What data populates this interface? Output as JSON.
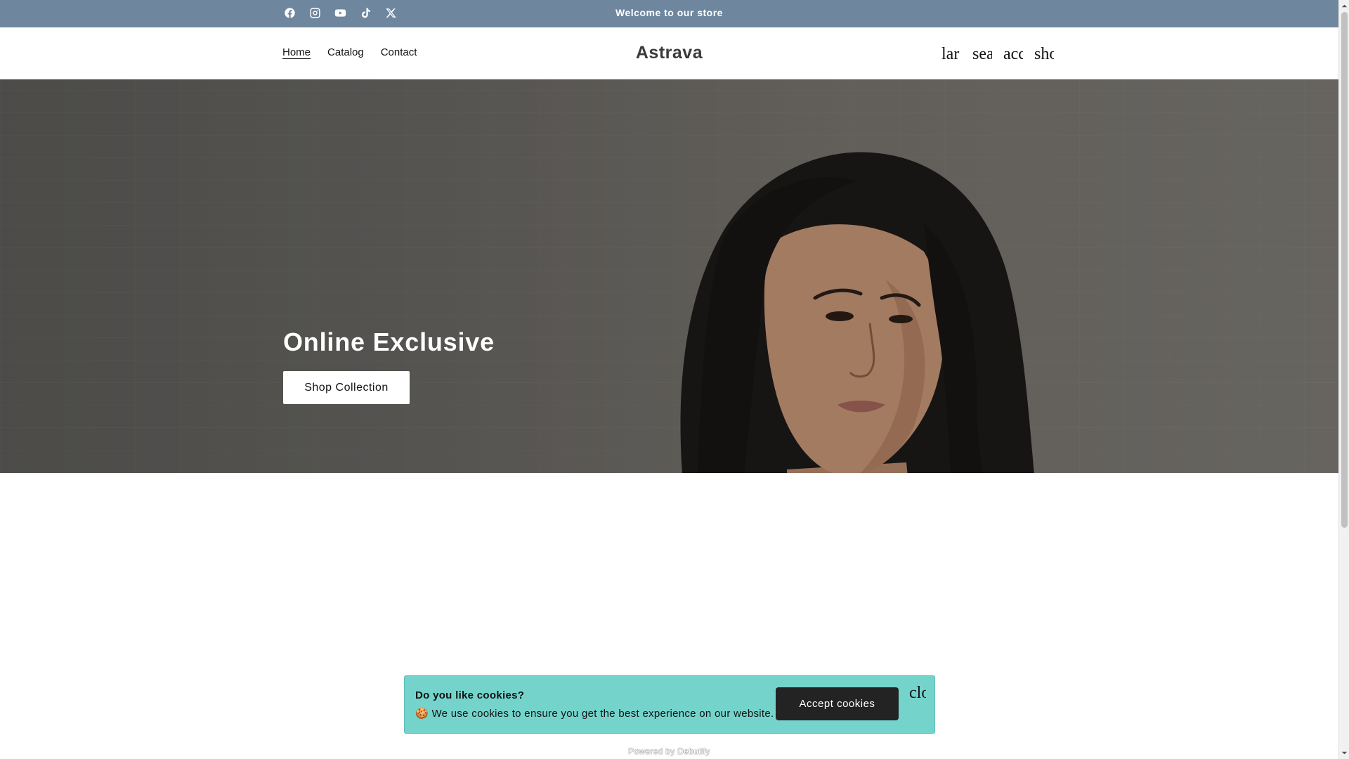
{
  "announcement": {
    "text": "Welcome to our store",
    "social_icons": [
      "facebook-icon",
      "instagram-icon",
      "youtube-icon",
      "tiktok-icon",
      "x-icon"
    ]
  },
  "header": {
    "nav": [
      {
        "label": "Home",
        "active": true
      },
      {
        "label": "Catalog",
        "active": false
      },
      {
        "label": "Contact",
        "active": false
      }
    ],
    "logo": "Astrava",
    "icons": [
      {
        "name": "language-icon",
        "text": "lar"
      },
      {
        "name": "search-icon",
        "text": "sea"
      },
      {
        "name": "account-icon",
        "text": "acc"
      },
      {
        "name": "cart-icon",
        "text": "sho"
      }
    ]
  },
  "hero": {
    "title": "Online Exclusive",
    "button_label": "Shop Collection"
  },
  "cookie_banner": {
    "title": "Do you like cookies?",
    "message": "🍪 We use cookies to ensure you get the best experience on our website.",
    "accept_label": "Accept cookies",
    "close_text": "clo"
  },
  "footer": {
    "powered_by": "Powered by Debutify"
  },
  "colors": {
    "announcement_bg": "#6e879e",
    "cookie_bg": "#74d4cc",
    "accept_button_bg": "#232323"
  }
}
